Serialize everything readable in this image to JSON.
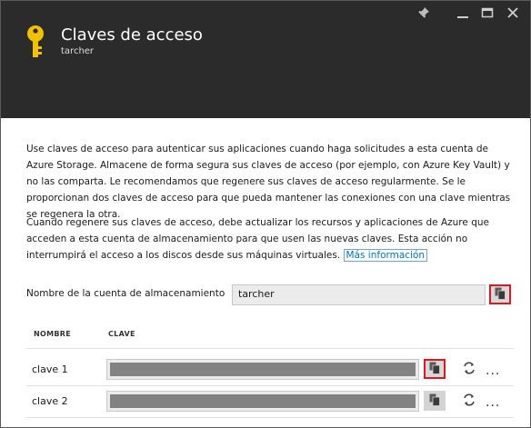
{
  "window": {
    "title": "Claves de acceso",
    "subtitle": "tarcher"
  },
  "icons": {
    "header": "key-icon",
    "pin": "pin-icon",
    "minimize": "minimize-icon",
    "maximize": "maximize-icon",
    "close": "close-icon",
    "copy": "copy-icon",
    "regenerate": "refresh-icon",
    "more": "ellipsis-icon"
  },
  "colors": {
    "header_bg": "#2b2b2b",
    "key_icon": "#f2c200",
    "link": "#0072c6",
    "highlight": "#e8141c"
  },
  "intro": {
    "paragraph1": "Use claves de acceso para autenticar sus aplicaciones cuando haga solicitudes a esta cuenta de Azure Storage. Almacene de forma segura sus claves de acceso (por ejemplo, con Azure Key Vault) y no las comparta. Le recomendamos que regenere sus claves de acceso regularmente. Se le proporcionan dos claves de acceso para que pueda mantener las conexiones con una clave mientras se regenera la otra.",
    "paragraph2": "Cuando regenere sus claves de acceso, debe actualizar los recursos y aplicaciones de Azure que acceden a esta cuenta de almacenamiento para que usen las nuevas claves. Esta acción no interrumpirá el acceso a los discos desde sus máquinas virtuales.",
    "more_info_link": "Más información"
  },
  "account": {
    "label": "Nombre de la cuenta de almacenamiento",
    "value": "tarcher"
  },
  "keys_table": {
    "col_name": "NOMBRE",
    "col_key": "CLAVE",
    "rows": [
      {
        "name": "clave 1",
        "more": "..."
      },
      {
        "name": "clave 2",
        "more": "..."
      }
    ]
  }
}
